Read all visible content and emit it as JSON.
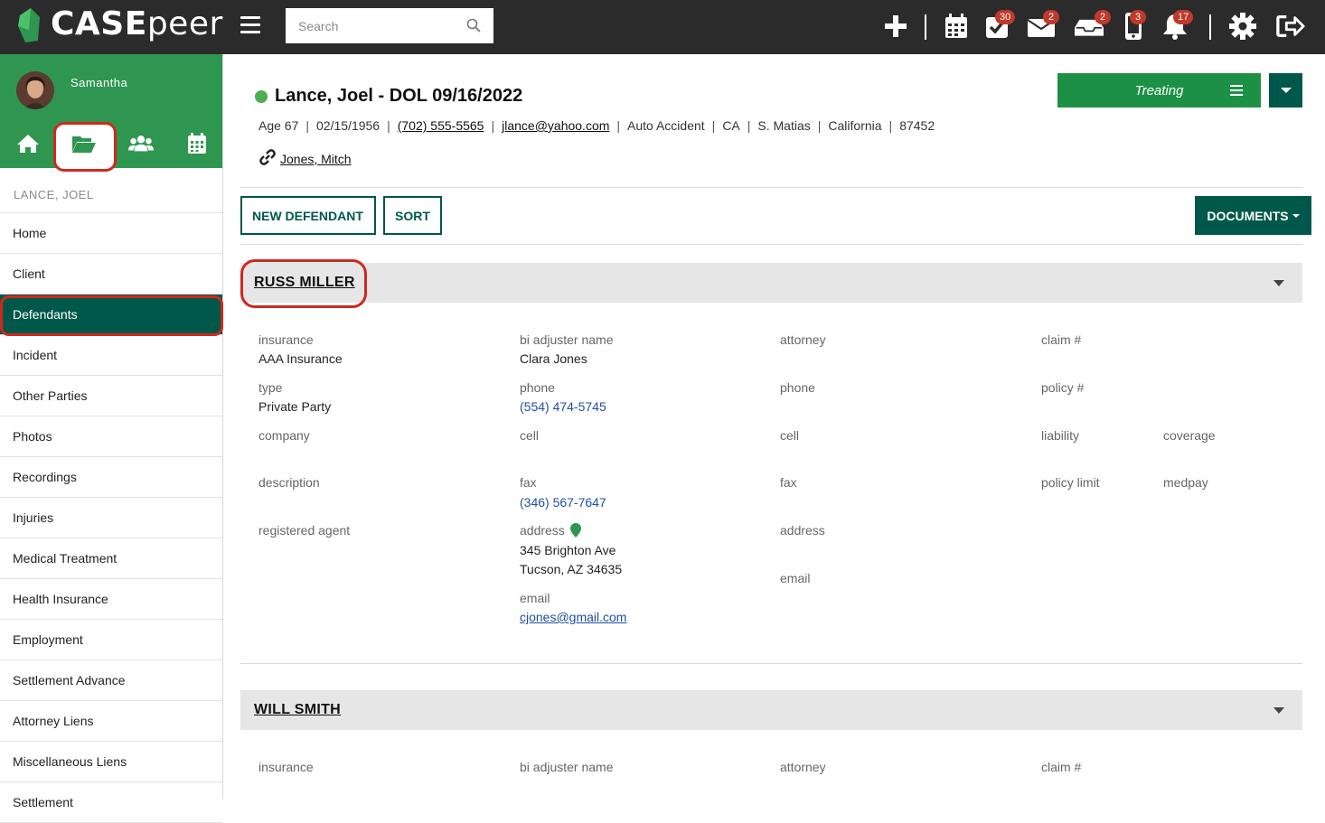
{
  "app": {
    "logo_text_caps": "CASE",
    "logo_text_lower": "peer",
    "search_placeholder": "Search",
    "badges": {
      "tasks": "30",
      "mail": "2",
      "inbox": "2",
      "phone": "3",
      "notifications": "17"
    },
    "brand_color": "#2e9650",
    "dark_green": "#00584a"
  },
  "sidebar": {
    "user_name": "Samantha",
    "case_label": "LANCE, JOEL",
    "items": [
      {
        "label": "Home"
      },
      {
        "label": "Client"
      },
      {
        "label": "Defendants"
      },
      {
        "label": "Incident"
      },
      {
        "label": "Other Parties"
      },
      {
        "label": "Photos"
      },
      {
        "label": "Recordings"
      },
      {
        "label": "Injuries"
      },
      {
        "label": "Medical Treatment"
      },
      {
        "label": "Health Insurance"
      },
      {
        "label": "Employment"
      },
      {
        "label": "Settlement Advance"
      },
      {
        "label": "Attorney Liens"
      },
      {
        "label": "Miscellaneous Liens"
      },
      {
        "label": "Settlement"
      }
    ]
  },
  "case": {
    "title": "Lance, Joel - DOL 09/16/2022",
    "age": "Age 67",
    "dob": "02/15/1956",
    "phone": "(702) 555-5565",
    "email": "jlance@yahoo.com",
    "case_type": "Auto Accident",
    "state_abbr": "CA",
    "attorney_initial": "S. Matias",
    "state": "California",
    "zip": "87452",
    "linked_contact": "Jones, Mitch",
    "status": "Treating"
  },
  "actions": {
    "new_defendant": "NEW DEFENDANT",
    "sort": "SORT",
    "documents": "DOCUMENTS"
  },
  "defendants": [
    {
      "name": "RUSS MILLER",
      "labels": {
        "insurance": "insurance",
        "type": "type",
        "company": "company",
        "description": "description",
        "registered_agent": "registered agent",
        "bi_adjuster_name": "bi adjuster name",
        "phone": "phone",
        "cell": "cell",
        "fax": "fax",
        "address": "address",
        "email": "email",
        "attorney": "attorney",
        "att_phone": "phone",
        "att_cell": "cell",
        "att_fax": "fax",
        "att_address": "address",
        "att_email": "email",
        "claim": "claim #",
        "policy": "policy #",
        "liability": "liability",
        "coverage": "coverage",
        "policy_limit": "policy limit",
        "medpay": "medpay"
      },
      "insurance": "AAA Insurance",
      "type": "Private Party",
      "bi_adjuster_name": "Clara Jones",
      "adjuster_phone": "(554) 474-5745",
      "adjuster_fax": "(346) 567-7647",
      "adjuster_address_line1": "345 Brighton Ave",
      "adjuster_address_line2": "Tucson, AZ 34635",
      "adjuster_email": "cjones@gmail.com"
    },
    {
      "name": "WILL SMITH",
      "labels": {
        "insurance": "insurance",
        "bi_adjuster_name": "bi adjuster name",
        "attorney": "attorney",
        "claim": "claim #"
      }
    }
  ]
}
